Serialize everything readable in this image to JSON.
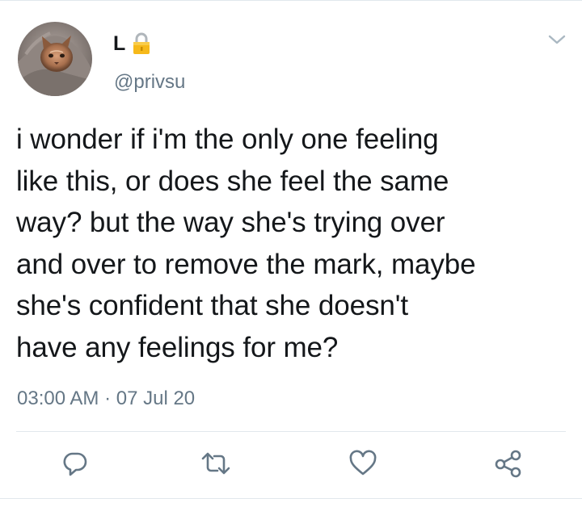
{
  "author": {
    "display_name": "L",
    "handle": "@privsu",
    "protected_icon": "lock-icon"
  },
  "tweet": {
    "text": "i wonder if i'm the only one feeling\nlike this, or does she feel the same\nway? but the way she's trying over\nand over to remove the mark, maybe\nshe's confident that she doesn't\nhave any feelings for me?",
    "timestamp": "03:00 AM · 07 Jul 20"
  },
  "actions": [
    {
      "name": "reply",
      "icon": "reply-icon"
    },
    {
      "name": "retweet",
      "icon": "retweet-icon"
    },
    {
      "name": "like",
      "icon": "heart-icon"
    },
    {
      "name": "share",
      "icon": "share-icon"
    }
  ],
  "colors": {
    "text": "#14171a",
    "secondary": "#657786",
    "icon": "#657786",
    "border": "#e1e8ed",
    "lock": "#f4b400"
  }
}
